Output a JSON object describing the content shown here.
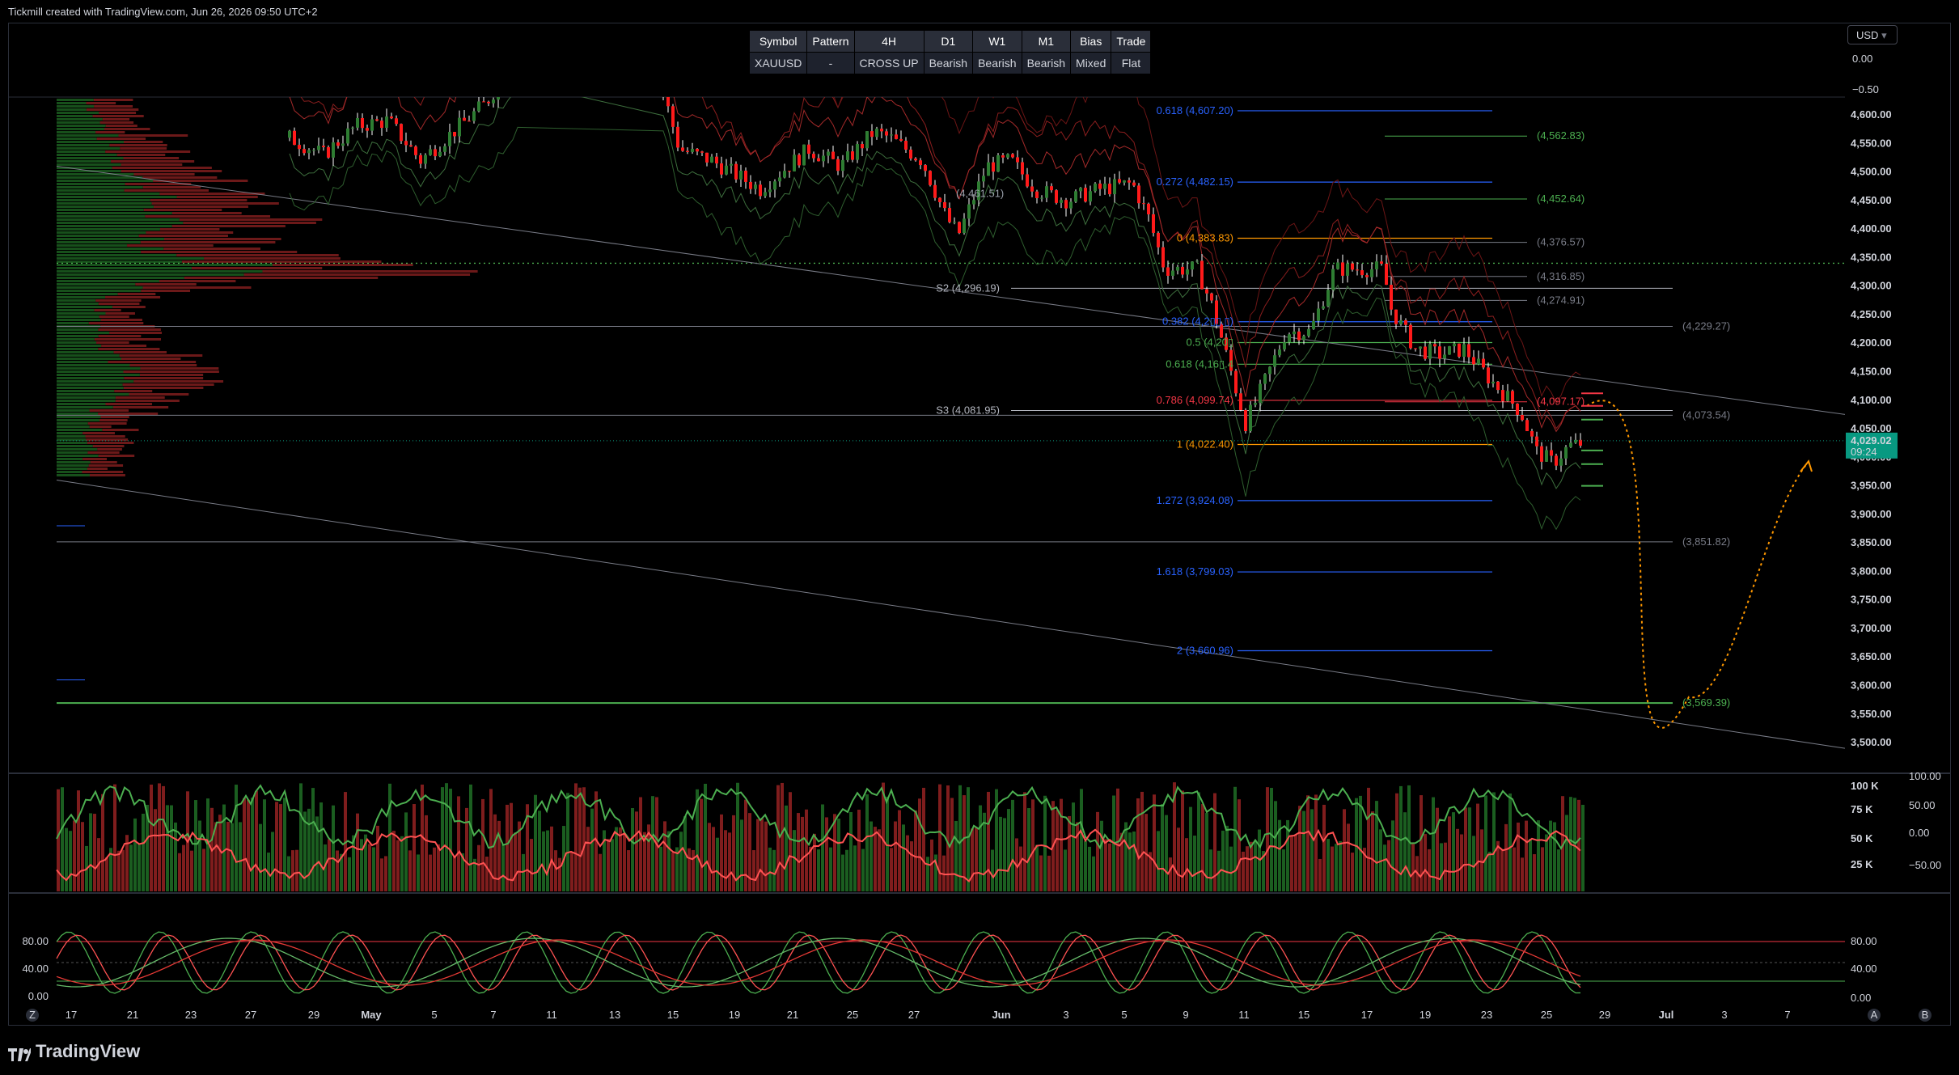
{
  "header": {
    "credit": "Tickmill created with TradingView.com, Jun 26, 2026 09:50 UTC+2"
  },
  "status_table": {
    "headers": [
      "Symbol",
      "Pattern",
      "4H",
      "D1",
      "W1",
      "M1",
      "Bias",
      "Trade"
    ],
    "values": [
      "XAUUSD",
      "-",
      "CROSS UP",
      "Bearish",
      "Bearish",
      "Bearish",
      "Mixed",
      "Flat"
    ]
  },
  "currency": "USD",
  "price_axis": {
    "osc_top_ticks": [
      "0.00",
      "−0.50"
    ],
    "ticks": [
      "4,600.00",
      "4,550.00",
      "4,500.00",
      "4,450.00",
      "4,400.00",
      "4,350.00",
      "4,300.00",
      "4,250.00",
      "4,200.00",
      "4,150.00",
      "4,100.00",
      "4,050.00",
      "4,000.00",
      "3,950.00",
      "3,900.00",
      "3,850.00",
      "3,800.00",
      "3,750.00",
      "3,700.00",
      "3,650.00",
      "3,600.00",
      "3,550.00",
      "3,500.00"
    ],
    "current_price": "4,029.02",
    "countdown": "09:24"
  },
  "fib_labels": [
    "0.618 (4,607.20)",
    "0.272 (4,482.15)",
    "0 (4,383.83)",
    "0.382 (4,2▯▯.▯)",
    "0.5 (4,20▯",
    "0.618 (4,16▯.4",
    "0.786 (4,099.74)",
    "1 (4,022.40)",
    "1.272 (3,924.08)",
    "1.618 (3,799.03)",
    "2 (3,660.96)"
  ],
  "pivot_labels": [
    "S2 (4,296.19)",
    "S3 (4,081.95)",
    "(4,461.51)"
  ],
  "level_labels": [
    "(4,562.83)",
    "(4,452.64)",
    "(4,376.57)",
    "(4,316.85)",
    "(4,274.91)",
    "(4,229.27)",
    "(4,097.17)",
    "(4,073.54)",
    "(3,851.82)",
    "(3,569.39)"
  ],
  "volume_axis": {
    "left": [
      "100 K",
      "75 K",
      "50 K",
      "25 K"
    ],
    "right": [
      "100.00",
      "50.00",
      "0.00",
      "−50.00"
    ]
  },
  "stoch_axis": {
    "left": [
      "80.00",
      "40.00",
      "0.00"
    ],
    "right": [
      "80.00",
      "40.00",
      "0.00"
    ]
  },
  "time_axis": [
    "17",
    "21",
    "23",
    "27",
    "29",
    "May",
    "5",
    "7",
    "11",
    "13",
    "15",
    "19",
    "21",
    "25",
    "27",
    "Jun",
    "3",
    "5",
    "9",
    "11",
    "15",
    "17",
    "19",
    "23",
    "25",
    "29",
    "Jul",
    "3",
    "7"
  ],
  "corner_badges": {
    "left": "Z",
    "right_a": "A",
    "right_b": "B"
  },
  "brand": "TradingView",
  "colors": {
    "bull": "#26a69a",
    "bear": "#ef5350",
    "green": "#4caf50",
    "red": "#f23645",
    "orange": "#ff9800",
    "blue": "#2962ff"
  }
}
